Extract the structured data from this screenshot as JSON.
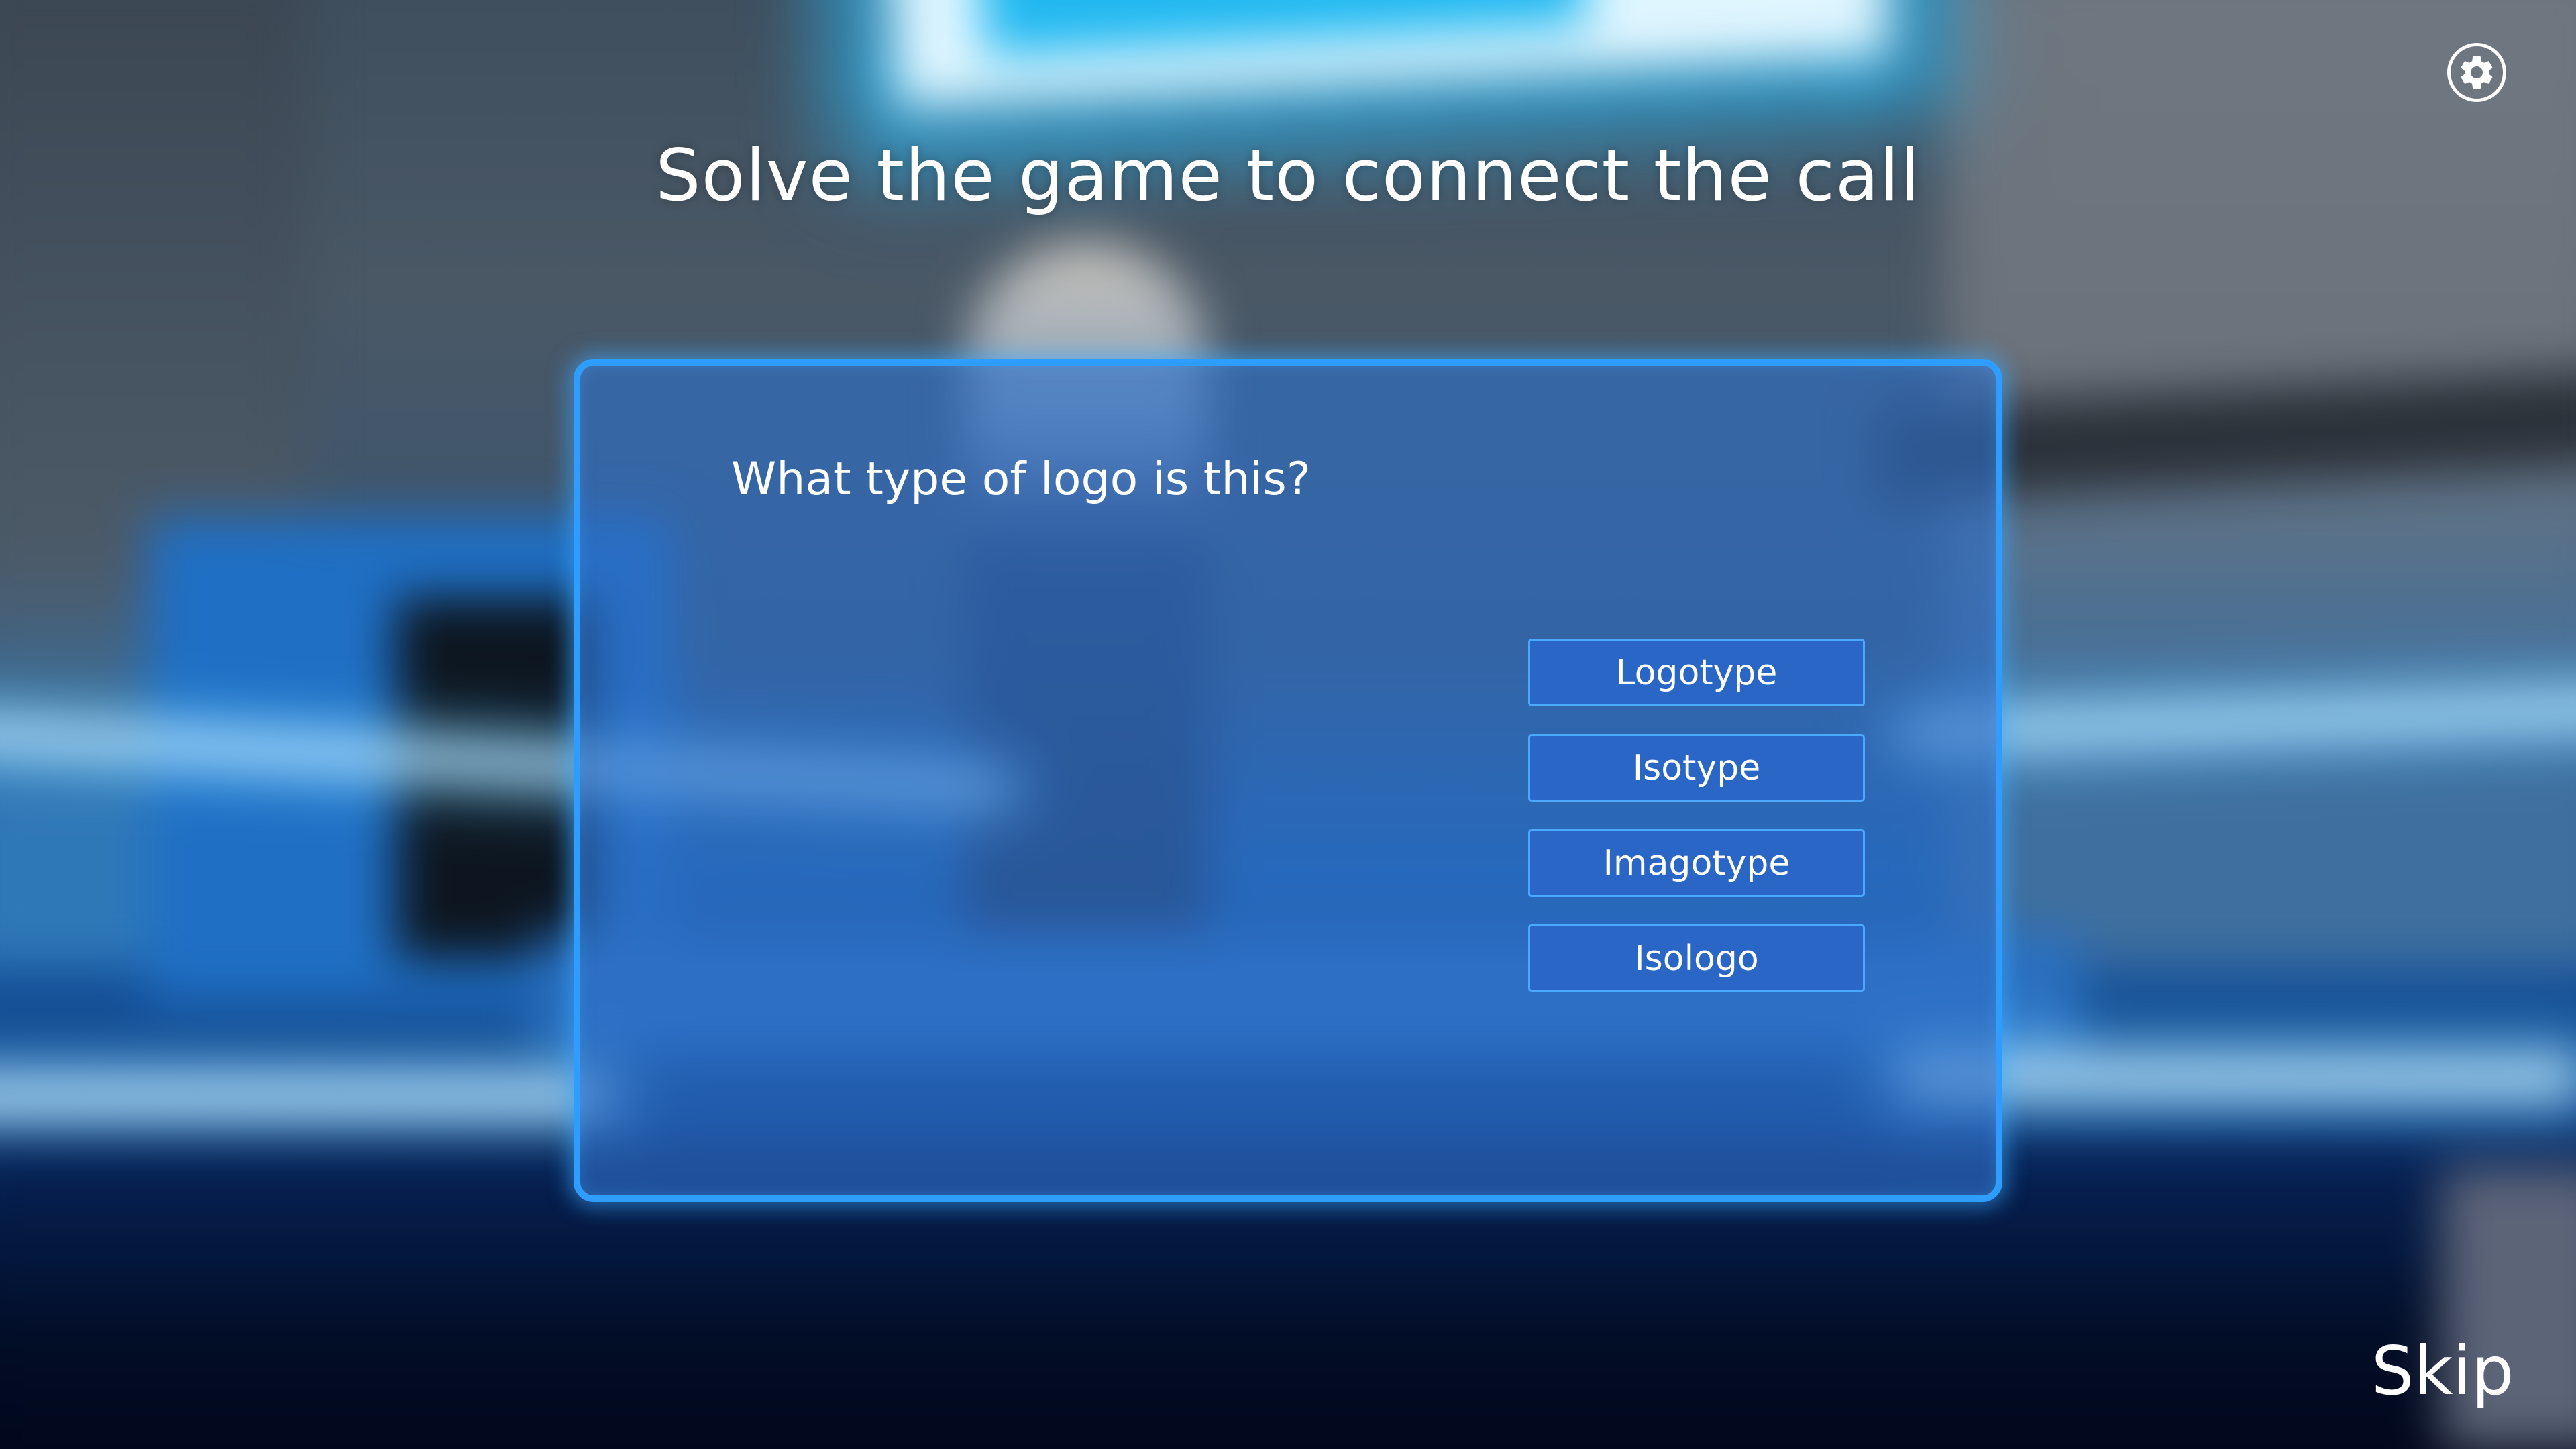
{
  "header": {
    "title": "Solve the game to connect the call",
    "settings_icon": "gear-icon"
  },
  "quiz": {
    "question": "What type of logo is this?",
    "options": [
      {
        "label": "Logotype"
      },
      {
        "label": "Isotype"
      },
      {
        "label": "Imagotype"
      },
      {
        "label": "Isologo"
      }
    ]
  },
  "footer": {
    "skip_label": "Skip"
  },
  "colors": {
    "panel_border": "#2f9dff",
    "panel_fill": "#2e70c8",
    "button_fill": "#2a66c6",
    "button_border": "#4aa8ff",
    "text": "#ffffff"
  }
}
